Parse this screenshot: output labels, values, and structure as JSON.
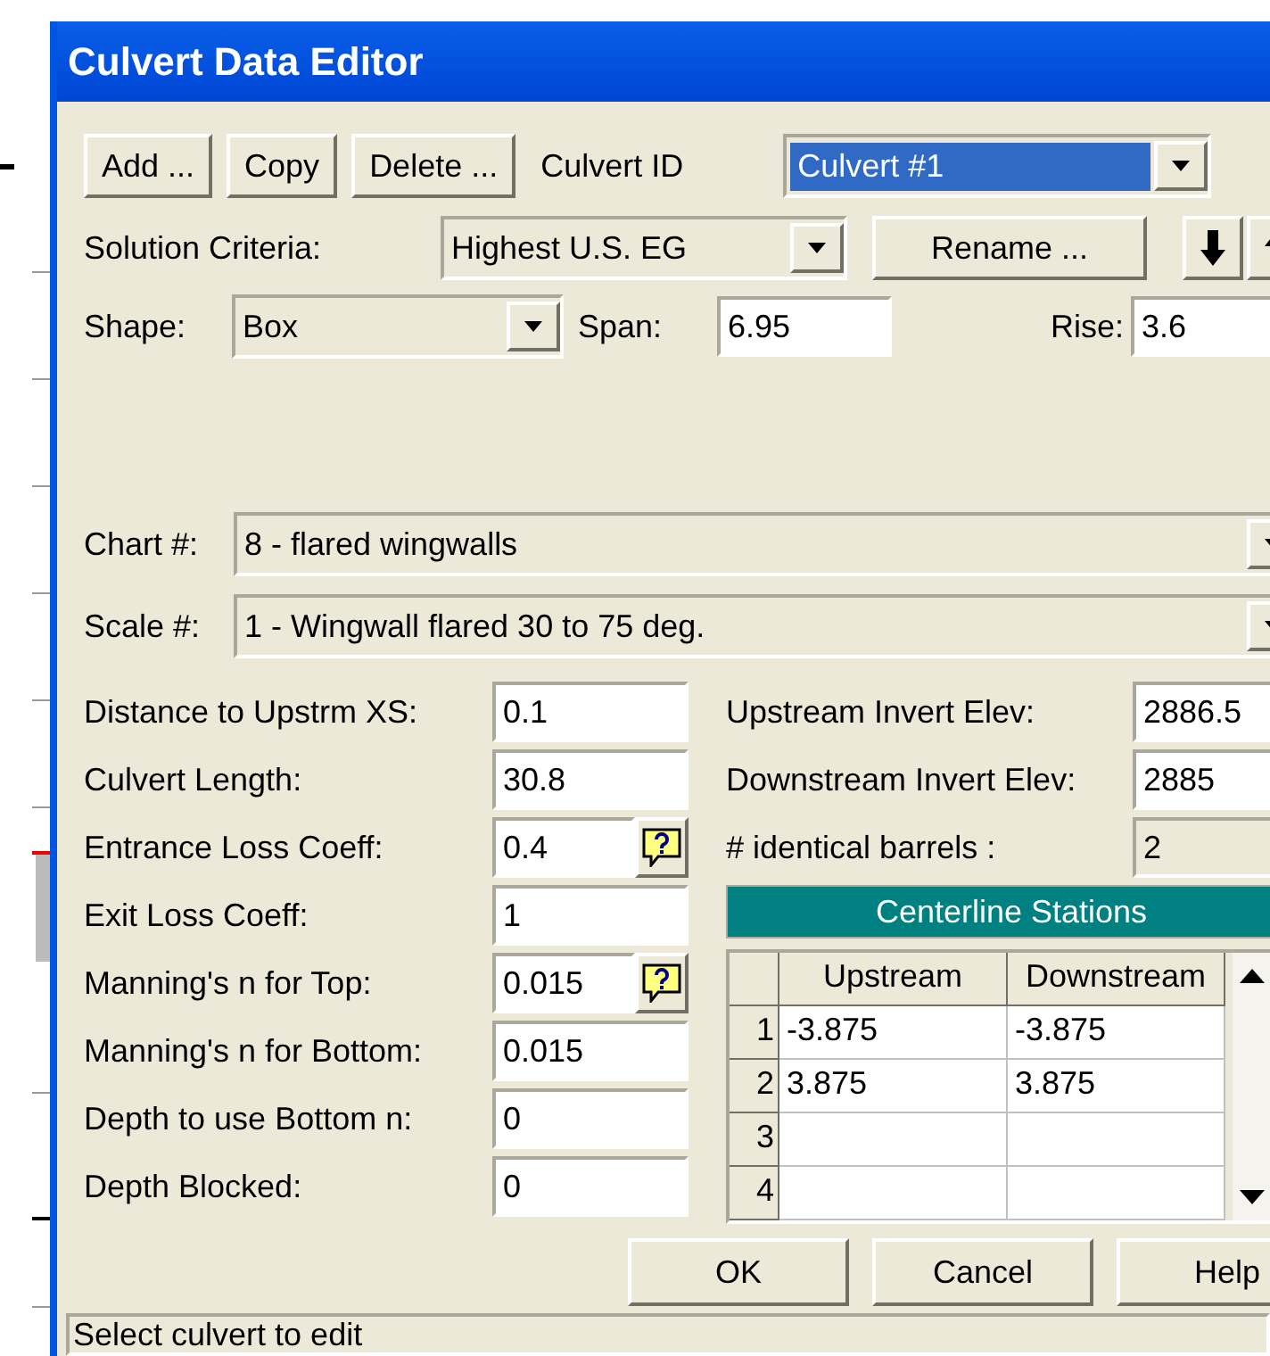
{
  "window": {
    "title": "Culvert Data Editor"
  },
  "toolbar": {
    "buttons": [
      "Add ...",
      "Copy",
      "Delete ..."
    ],
    "culvert_id": {
      "label": "Culvert ID",
      "value": "Culvert #1",
      "focused": true
    }
  },
  "solution_criteria": {
    "label": "Solution Criteria:",
    "value": "Highest U.S. EG"
  },
  "rename_button": "Rename ...",
  "shape": {
    "label": "Shape:",
    "value": "Box"
  },
  "span": {
    "label": "Span:",
    "value": "6.95"
  },
  "rise": {
    "label": "Rise:",
    "value": "3.6"
  },
  "chart": {
    "label": "Chart #:",
    "value": "8 - flared wingwalls"
  },
  "scale": {
    "label": "Scale #:",
    "value": "1 - Wingwall flared 30 to 75 deg."
  },
  "left_fields": [
    {
      "label": "Distance to Upstrm XS:",
      "value": "0.1",
      "help": false
    },
    {
      "label": "Culvert Length:",
      "value": "30.8",
      "help": false
    },
    {
      "label": "Entrance Loss Coeff:",
      "value": "0.4",
      "help": true
    },
    {
      "label": "Exit Loss Coeff:",
      "value": "1",
      "help": false
    },
    {
      "label": "Manning's n for Top:",
      "value": "0.015",
      "help": true
    },
    {
      "label": "Manning's n for Bottom:",
      "value": "0.015",
      "help": false
    },
    {
      "label": "Depth to use Bottom n:",
      "value": "0",
      "help": false
    },
    {
      "label": "Depth Blocked:",
      "value": "0",
      "help": false
    }
  ],
  "right_fields": [
    {
      "label": "Upstream Invert Elev:",
      "value": "2886.5",
      "disabled": false
    },
    {
      "label": "Downstream Invert Elev:",
      "value": "2885",
      "disabled": false
    },
    {
      "label": "# identical barrels :",
      "value": "2",
      "disabled": true
    }
  ],
  "centerline_stations": {
    "title": "Centerline Stations",
    "columns": [
      "Upstream",
      "Downstream"
    ],
    "rows": [
      {
        "number": "1",
        "cells": [
          "-3.875",
          "-3.875"
        ]
      },
      {
        "number": "2",
        "cells": [
          "3.875",
          "3.875"
        ]
      },
      {
        "number": "3",
        "cells": []
      },
      {
        "number": "4",
        "cells": []
      }
    ]
  },
  "buttons": [
    "OK",
    "Cancel",
    "Help"
  ],
  "status_bar": "Select culvert to edit"
}
